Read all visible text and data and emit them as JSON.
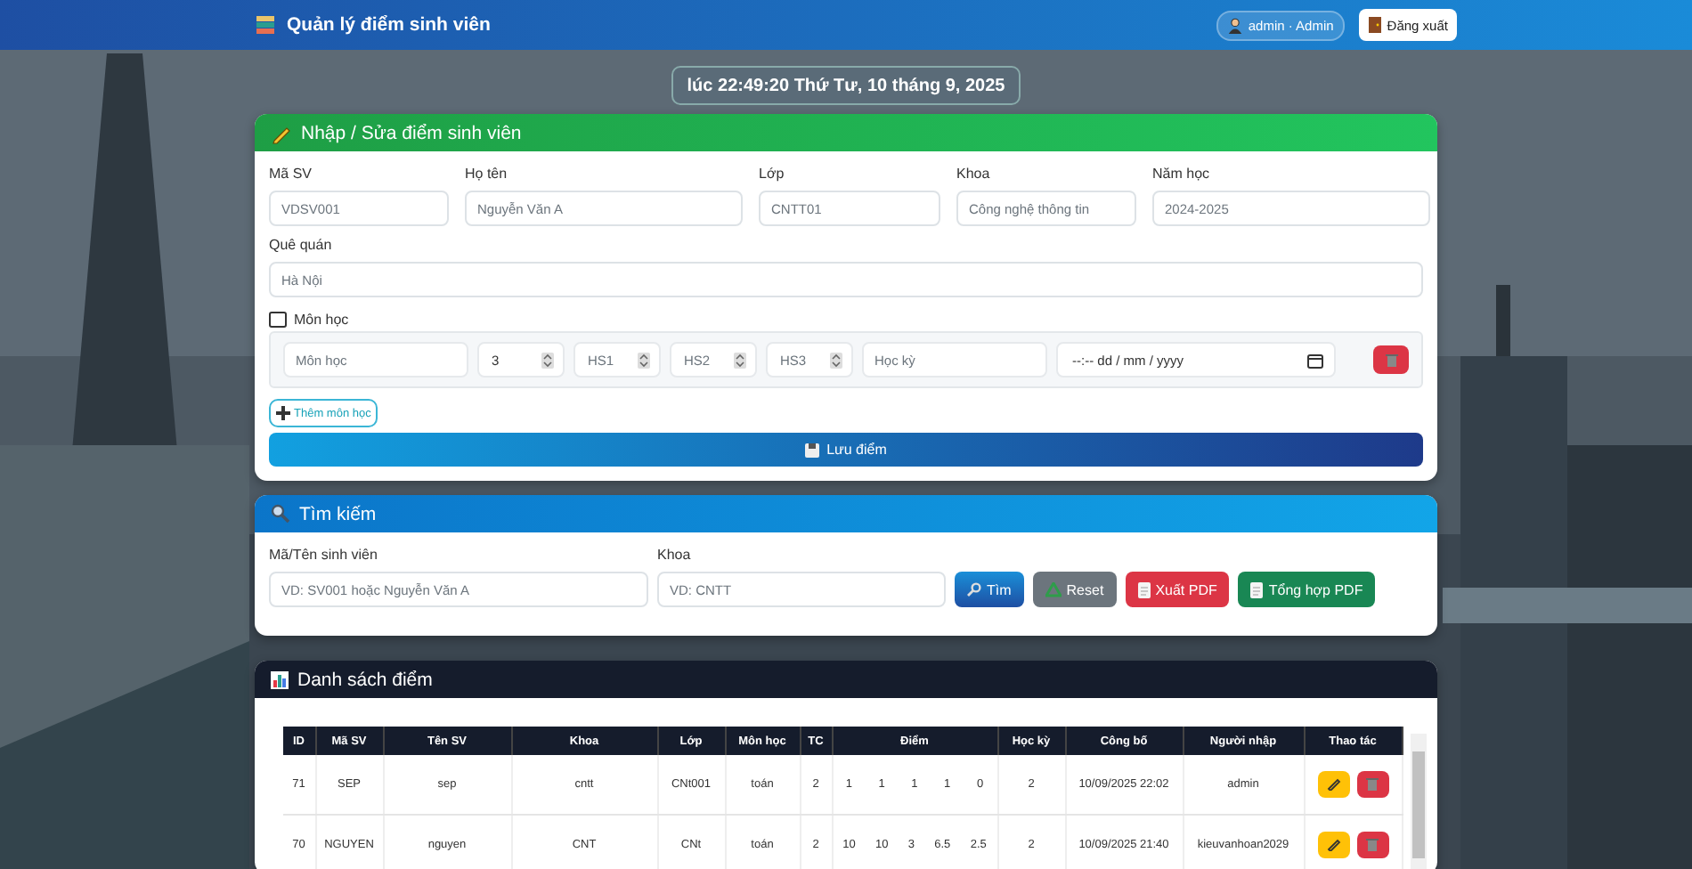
{
  "header": {
    "title": "Quản lý điểm sinh viên",
    "user": "admin · Admin",
    "logout": "Đăng xuất"
  },
  "datetime": "lúc 22:49:20 Thứ Tư, 10 tháng 9, 2025",
  "entry_form": {
    "title": "Nhập / Sửa điểm sinh viên",
    "fields": [
      {
        "label": "Mã SV",
        "placeholder": "VDSV001"
      },
      {
        "label": "Họ tên",
        "placeholder": "Nguyễn Văn A"
      },
      {
        "label": "Lớp",
        "placeholder": "CNTT01"
      },
      {
        "label": "Khoa",
        "placeholder": "Công nghệ thông tin"
      },
      {
        "label": "Năm học",
        "placeholder": "2024-2025"
      }
    ],
    "hometown": {
      "label": "Quê quán",
      "placeholder": "Hà Nội"
    },
    "subjects_label": "Môn học",
    "subject_inputs": [
      {
        "kind": "text",
        "placeholder": "Môn học"
      },
      {
        "kind": "number",
        "value": "3"
      },
      {
        "kind": "number",
        "placeholder": "HS1"
      },
      {
        "kind": "number",
        "placeholder": "HS2"
      },
      {
        "kind": "number",
        "placeholder": "HS3"
      },
      {
        "kind": "text",
        "placeholder": "Học kỳ"
      },
      {
        "kind": "datetime",
        "placeholder": "--:--  dd / mm / yyyy"
      }
    ],
    "add_button": "Thêm môn học",
    "save_button": "Lưu điểm"
  },
  "search": {
    "title": "Tìm kiếm",
    "fields": [
      {
        "label": "Mã/Tên sinh viên",
        "placeholder": "VD: SV001 hoặc Nguyễn Văn A"
      },
      {
        "label": "Khoa",
        "placeholder": "VD: CNTT"
      }
    ],
    "buttons": [
      {
        "kind": "search",
        "label": "Tìm"
      },
      {
        "kind": "reset",
        "label": "Reset"
      },
      {
        "kind": "pdf",
        "label": "Xuất PDF"
      },
      {
        "kind": "summary",
        "label": "Tổng hợp PDF"
      }
    ]
  },
  "grades": {
    "title": "Danh sách điểm",
    "columns": [
      "ID",
      "Mã SV",
      "Tên SV",
      "Khoa",
      "Lớp",
      "Môn học",
      "TC",
      "Điểm",
      "Học kỳ",
      "Công bố",
      "Người nhập",
      "Thao tác"
    ],
    "rows": [
      {
        "id": "71",
        "student_id": "SEP",
        "name": "sep",
        "faculty": "cntt",
        "class": "CNt001",
        "subject": "toán",
        "credits": "2",
        "scores": [
          "1",
          "1",
          "1",
          "1",
          "0"
        ],
        "semester": "2",
        "published": "10/09/2025 22:02",
        "entered_by": "admin"
      },
      {
        "id": "70",
        "student_id": "NGUYEN",
        "name": "nguyen",
        "faculty": "CNT",
        "class": "CNt",
        "subject": "toán",
        "credits": "2",
        "scores": [
          "10",
          "10",
          "3",
          "6.5",
          "2.5"
        ],
        "semester": "2",
        "published": "10/09/2025 21:40",
        "entered_by": "kieuvanhoan2029"
      }
    ]
  }
}
